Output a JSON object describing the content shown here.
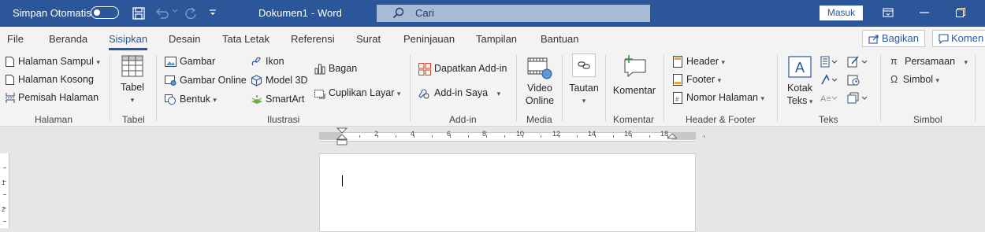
{
  "titlebar": {
    "autosave_label": "Simpan Otomatis",
    "autosave_state": "off",
    "document_name": "Dokumen1",
    "separator": "-",
    "app_name": "Word",
    "search_placeholder": "Cari",
    "signin_label": "Masuk",
    "icons": [
      "save-icon",
      "undo-icon",
      "redo-icon",
      "customize-toolbar-icon",
      "ribbon-display-icon",
      "restore-icon"
    ],
    "background": "#2b579a"
  },
  "tabs": {
    "items": [
      "File",
      "Beranda",
      "Sisipkan",
      "Desain",
      "Tata Letak",
      "Referensi",
      "Surat",
      "Peninjauan",
      "Tampilan",
      "Bantuan"
    ],
    "active": "Sisipkan",
    "share_label": "Bagikan",
    "comments_label": "Komen"
  },
  "ribbon": {
    "halaman": {
      "group_label": "Halaman",
      "cover": "Halaman Sampul",
      "blank": "Halaman Kosong",
      "break": "Pemisah Halaman"
    },
    "tabel": {
      "group_label": "Tabel",
      "button": "Tabel"
    },
    "ilustrasi": {
      "group_label": "Ilustrasi",
      "gambar": "Gambar",
      "gambar_online": "Gambar Online",
      "bentuk": "Bentuk",
      "ikon": "Ikon",
      "model3d": "Model 3D",
      "smartart": "SmartArt",
      "bagan": "Bagan",
      "cuplikan": "Cuplikan Layar"
    },
    "addin": {
      "group_label": "Add-in",
      "get": "Dapatkan Add-in",
      "mine": "Add-in Saya"
    },
    "media": {
      "group_label": "Media",
      "line1": "Video",
      "line2": "Online"
    },
    "tautan": {
      "label": "Tautan"
    },
    "komentar": {
      "group_label": "Komentar",
      "button": "Komentar"
    },
    "header_footer": {
      "group_label": "Header & Footer",
      "header": "Header",
      "footer": "Footer",
      "page_number": "Nomor Halaman"
    },
    "teks": {
      "group_label": "Teks",
      "line1": "Kotak",
      "line2": "Teks"
    },
    "simbol": {
      "group_label": "Simbol",
      "equation": "Persamaan",
      "symbol": "Simbol"
    }
  },
  "ruler": {
    "numbers": [
      "2",
      "4",
      "6",
      "8",
      "10",
      "12",
      "14",
      "16",
      "18"
    ]
  },
  "vertical_ruler": {
    "numbers": [
      "1",
      "2"
    ]
  },
  "accent_color": "#2b579a"
}
